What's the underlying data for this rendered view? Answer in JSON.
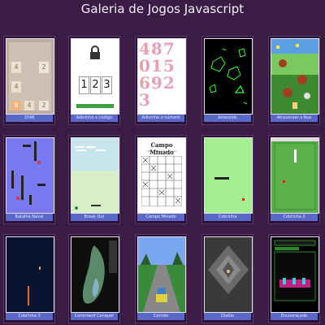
{
  "page": {
    "title": "Galeria de Jogos Javascript"
  },
  "games": [
    {
      "name": "2048",
      "tiles": [
        "4",
        "2",
        "4",
        "8",
        "4",
        "2"
      ]
    },
    {
      "name": "Adivinhe o código",
      "digits": [
        "1",
        "2",
        "3"
      ]
    },
    {
      "name": "Adivinhe o número",
      "numbers": "4870156923"
    },
    {
      "name": "Asteroids"
    },
    {
      "name": "Atravessar a Rua"
    },
    {
      "name": "Batalha Naval"
    },
    {
      "name": "Break Out"
    },
    {
      "name": "Campo Minado",
      "heading": "Campo Minado",
      "sub": "Vire o mouse para jogar"
    },
    {
      "name": "Cobrinha"
    },
    {
      "name": "Cobrinha 2"
    },
    {
      "name": "Cobrinha 3"
    },
    {
      "name": "Command Conquer"
    },
    {
      "name": "Corrida"
    },
    {
      "name": "Diablo"
    },
    {
      "name": "Encouraçado"
    }
  ],
  "colors": {
    "background": "#3a1c44",
    "label_bar": "#5a68c8"
  }
}
